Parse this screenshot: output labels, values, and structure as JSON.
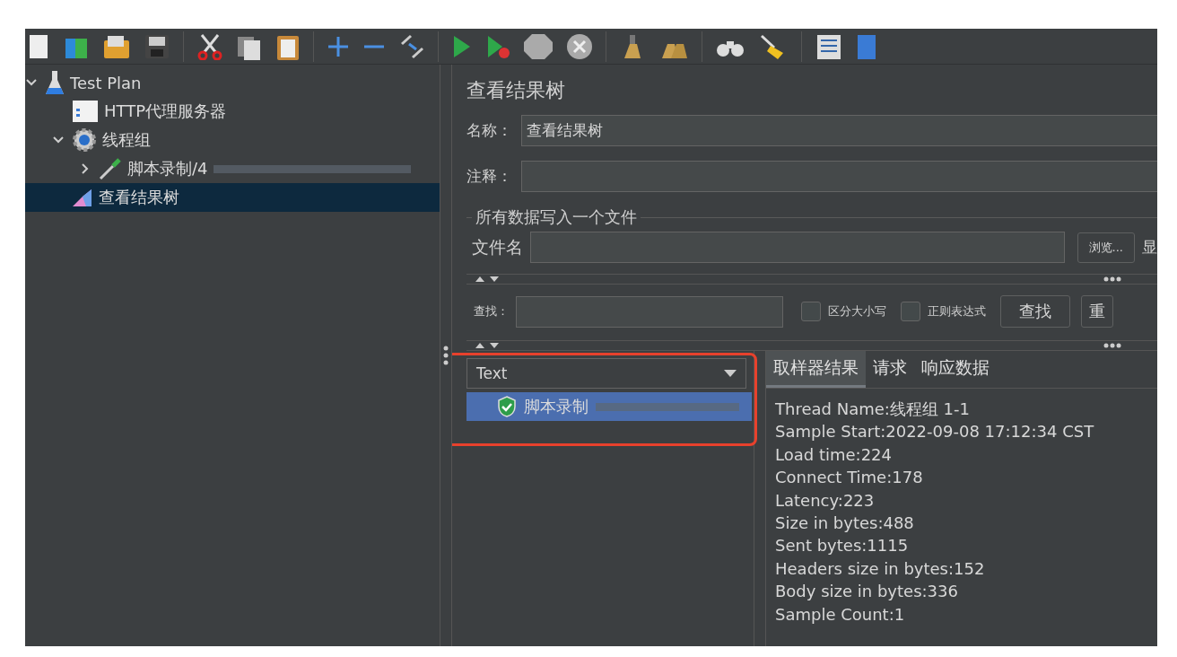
{
  "tree": [
    {
      "label": "Test Plan",
      "kind": "flask",
      "expanded": true,
      "selected": false,
      "children": [
        {
          "label": "HTTP代理服务器",
          "kind": "proxy",
          "selected": false
        },
        {
          "label": "线程组",
          "kind": "gear",
          "expanded": true,
          "selected": false,
          "children": [
            {
              "label": "脚本录制/4",
              "kind": "dropper",
              "expanded": false,
              "selected": false,
              "redacted": true
            }
          ]
        },
        {
          "label": "查看结果树",
          "kind": "graph",
          "selected": true
        }
      ]
    }
  ],
  "panel": {
    "title": "查看结果树",
    "name_label": "名称：",
    "name_value": "查看结果树",
    "comment_label": "注释：",
    "file_group": "所有数据写入一个文件",
    "file_label": "文件名",
    "browse": "浏览...",
    "cut_label": "显",
    "search_label": "查找：",
    "options": [
      {
        "label": "区分大小写",
        "checked": false
      },
      {
        "label": "正则表达式",
        "checked": false
      }
    ],
    "search_button": "查找",
    "cut_button": "重"
  },
  "results": {
    "renderer": "Text",
    "items": [
      {
        "label": "脚本录制",
        "kind": "success",
        "selected": true,
        "redacted": true
      }
    ],
    "tabs": [
      {
        "label": "取样器结果",
        "selected": true
      },
      {
        "label": "请求",
        "selected": false
      },
      {
        "label": "响应数据",
        "selected": false
      }
    ],
    "lines": [
      "Thread Name:线程组 1-1",
      "Sample Start:2022-09-08 17:12:34 CST",
      "Load time:224",
      "Connect Time:178",
      "Latency:223",
      "Size in bytes:488",
      "Sent bytes:1115",
      "Headers size in bytes:152",
      "Body size in bytes:336",
      "Sample Count:1"
    ]
  }
}
